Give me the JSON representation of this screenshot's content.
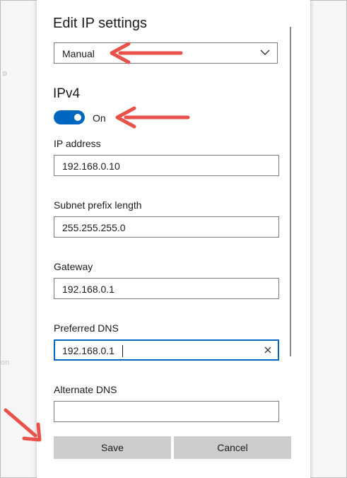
{
  "dialog": {
    "title": "Edit IP settings",
    "mode_select": {
      "value": "Manual"
    },
    "section_title": "IPv4",
    "toggle": {
      "state_label": "On",
      "on": true
    },
    "fields": [
      {
        "label": "IP address",
        "value": "192.168.0.10"
      },
      {
        "label": "Subnet prefix length",
        "value": "255.255.255.0"
      },
      {
        "label": "Gateway",
        "value": "192.168.0.1"
      },
      {
        "label": "Preferred DNS",
        "value": "192.168.0.1"
      },
      {
        "label": "Alternate DNS",
        "value": ""
      }
    ],
    "buttons": {
      "save": "Save",
      "cancel": "Cancel"
    }
  },
  "colors": {
    "accent": "#0067c0",
    "annotation_arrow": "#e8524a",
    "button_bg": "#cccccc"
  },
  "icons": [
    "chevron-down-icon",
    "clear-icon"
  ]
}
